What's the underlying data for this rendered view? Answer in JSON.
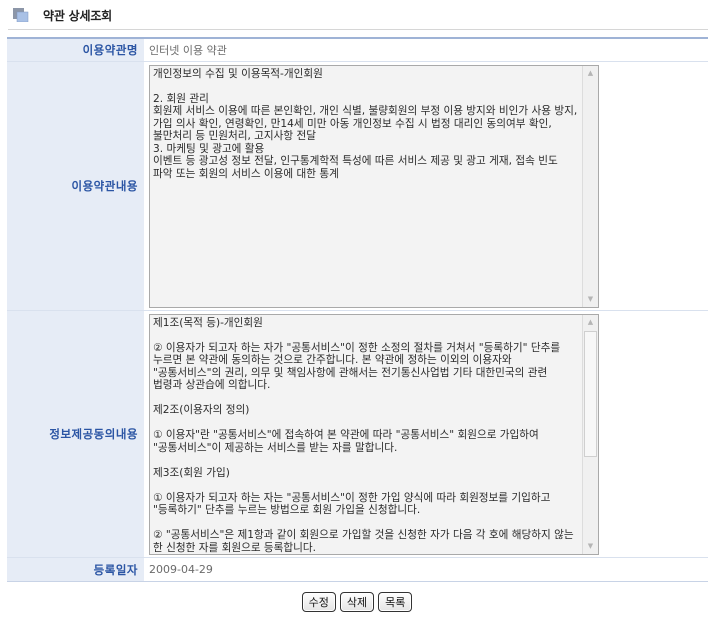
{
  "header": {
    "title": "약관 상세조회"
  },
  "fields": {
    "terms_title_label": "이용약관명",
    "terms_title_value": "인터넷 이용 약관",
    "terms_content_label": "이용약관내용",
    "terms_content_value": "개인정보의 수집 및 이용목적-개인회원\n\n2. 회원 관리\n회원제 서비스 이용에 따른 본인확인, 개인 식별, 불량회원의 부정 이용 방지와 비인가 사용 방지, 가입 의사 확인, 연령확인, 만14세 미만 아동 개인정보 수집 시 법정 대리인 동의여부 확인, 불만처리 등 민원처리, 고지사항 전달\n3. 마케팅 및 광고에 활용\n이벤트 등 광고성 정보 전달, 인구통계학적 특성에 따른 서비스 제공 및 광고 게재, 접속 빈도 파악 또는 회원의 서비스 이용에 대한 통계",
    "info_consent_label": "정보제공동의내용",
    "info_consent_value": "제1조(목적 등)-개인회원\n\n② 이용자가 되고자 하는 자가 \"공통서비스\"이 정한 소정의 절차를 거쳐서 \"등록하기\" 단추를 누르면 본 약관에 동의하는 것으로 간주합니다. 본 약관에 정하는 이외의 이용자와 \"공통서비스\"의 권리, 의무 및 책임사항에 관해서는 전기통신사업법 기타 대한민국의 관련 법령과 상관습에 의합니다.\n\n제2조(이용자의 정의)\n\n① 이용자\"란 \"공통서비스\"에 접속하여 본 약관에 따라 \"공통서비스\" 회원으로 가입하여 \"공통서비스\"이 제공하는 서비스를 받는 자를 말합니다.\n\n제3조(회원 가입)\n\n① 이용자가 되고자 하는 자는 \"공통서비스\"이 정한 가입 양식에 따라 회원정보를 기입하고 \"등록하기\" 단추를 누르는 방법으로 회원 가입을 신청합니다.\n\n② \"공통서비스\"은 제1항과 같이 회원으로 가입할 것을 신청한 자가 다음 각 호에 해당하지 않는 한 신청한 자를 회원으로 등록합니다.",
    "reg_date_label": "등록일자",
    "reg_date_value": "2009-04-29"
  },
  "buttons": {
    "edit": "수정",
    "delete": "삭제",
    "list": "목록"
  },
  "icons": {
    "title_bullet": "title-bullet-icon",
    "scroll_up": "scroll-up-arrow-icon",
    "scroll_down": "scroll-down-arrow-icon"
  },
  "colors": {
    "label_bg": "#e6ecf6",
    "label_text": "#2b55a4",
    "table_border": "#9fb3d6"
  }
}
